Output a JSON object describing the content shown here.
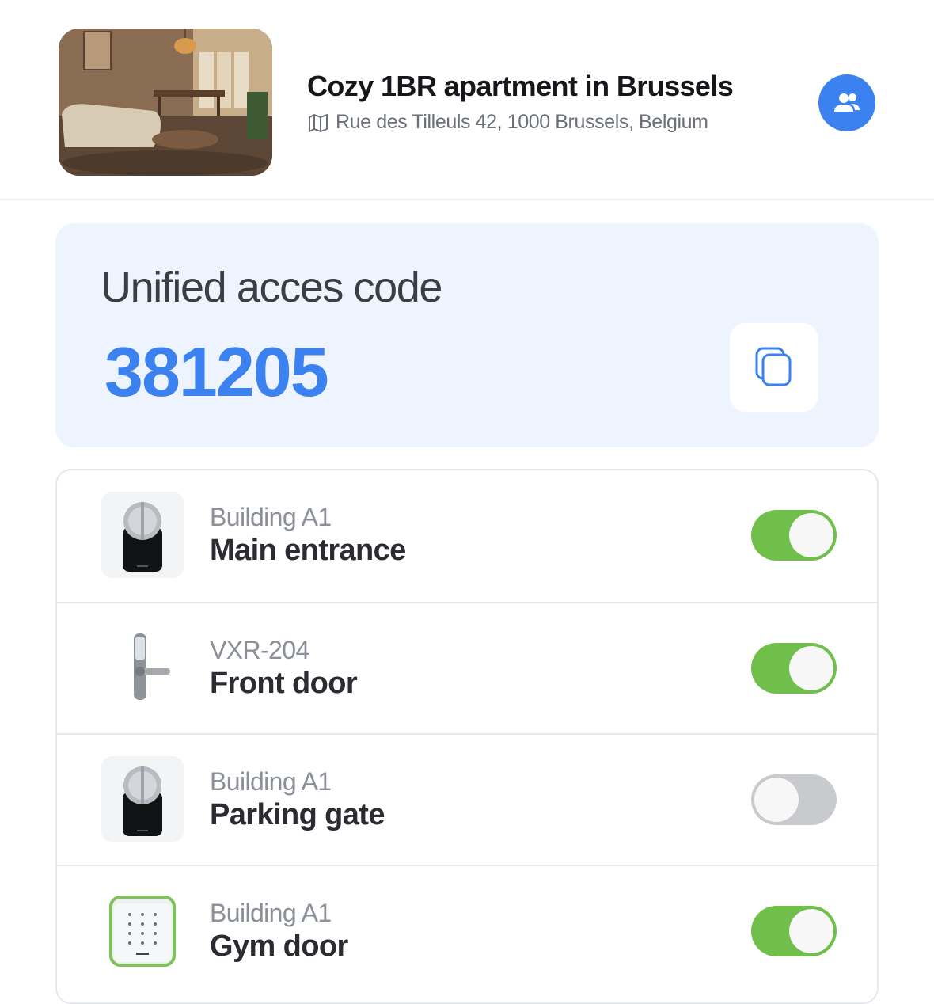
{
  "property": {
    "title": "Cozy 1BR apartment in Brussels",
    "address": "Rue des Tilleuls 42, 1000 Brussels, Belgium"
  },
  "access_code": {
    "label": "Unified acces code",
    "code": "381205"
  },
  "locks": [
    {
      "sub": "Building A1",
      "name": "Main entrance",
      "device_icon": "smart-lock-icon",
      "enabled": true
    },
    {
      "sub": "VXR-204",
      "name": "Front door",
      "device_icon": "keypad-handle-lock-icon",
      "enabled": true
    },
    {
      "sub": "Building A1",
      "name": "Parking gate",
      "device_icon": "smart-lock-icon",
      "enabled": false
    },
    {
      "sub": "Building A1",
      "name": "Gym door",
      "device_icon": "wall-keypad-icon",
      "enabled": true
    }
  ],
  "colors": {
    "accent": "#3b82f0",
    "toggle_on": "#6fbf4a",
    "toggle_off": "#c9cacd",
    "card_bg": "#eef4fe"
  },
  "icons": {
    "header": [
      "map-icon",
      "guests-icon"
    ],
    "code_card": [
      "copy-icon"
    ]
  }
}
